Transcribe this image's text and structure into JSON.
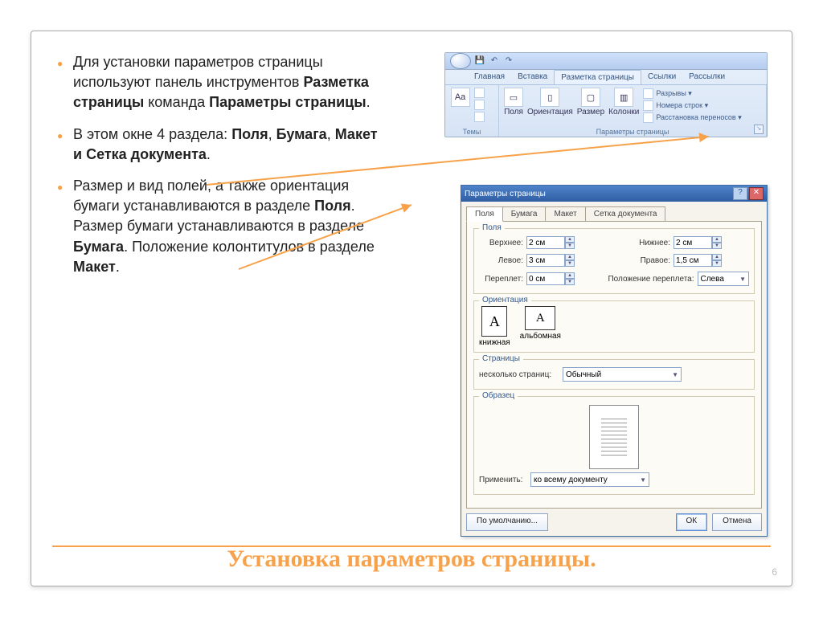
{
  "bullets": {
    "p1_a": "Для установки параметров страницы используют панель инструментов ",
    "p1_b": "Разметка страницы",
    "p1_c": " команда ",
    "p1_d": "Параметры страницы",
    "p1_e": ".",
    "p2_a": "В этом окне 4 раздела: ",
    "p2_b": "Поля",
    "p2_c": ", ",
    "p2_d": "Бумага",
    "p2_e": ", ",
    "p2_f": "Макет и Сетка документа",
    "p2_g": ".",
    "p3_a": "Размер и вид полей, а также ориентация бумаги устанавливаются в разделе ",
    "p3_b": "Поля",
    "p3_c": ". Размер бумаги устанавливаются в разделе ",
    "p3_d": "Бумага",
    "p3_e": ". Положение колонтитулов в разделе ",
    "p3_f": "Макет",
    "p3_g": "."
  },
  "title": "Установка параметров страницы.",
  "pagenum": "6",
  "ribbon": {
    "tabs": [
      "Главная",
      "Вставка",
      "Разметка страницы",
      "Ссылки",
      "Рассылки"
    ],
    "active_tab": 2,
    "group_themes": "Темы",
    "group_page": "Параметры страницы",
    "btn_fields": "Поля",
    "btn_orient": "Ориентация",
    "btn_size": "Размер",
    "btn_columns": "Колонки",
    "small_breaks": "Разрывы ▾",
    "small_lines": "Номера строк ▾",
    "small_hyphen": "Расстановка переносов ▾"
  },
  "dialog": {
    "title": "Параметры страницы",
    "tabs": [
      "Поля",
      "Бумага",
      "Макет",
      "Сетка документа"
    ],
    "active_tab": 0,
    "group_fields": "Поля",
    "lbl_top": "Верхнее:",
    "val_top": "2 см",
    "lbl_bottom": "Нижнее:",
    "val_bottom": "2 см",
    "lbl_left": "Левое:",
    "val_left": "3 см",
    "lbl_right": "Правое:",
    "val_right": "1,5 см",
    "lbl_gutter": "Переплет:",
    "val_gutter": "0 см",
    "lbl_gutterpos": "Положение переплета:",
    "val_gutterpos": "Слева",
    "group_orient": "Ориентация",
    "orient_port": "книжная",
    "orient_land": "альбомная",
    "group_pages": "Страницы",
    "lbl_multi": "несколько страниц:",
    "val_multi": "Обычный",
    "group_preview": "Образец",
    "lbl_apply": "Применить:",
    "val_apply": "ко всему документу",
    "btn_default": "По умолчанию...",
    "btn_ok": "ОК",
    "btn_cancel": "Отмена"
  }
}
